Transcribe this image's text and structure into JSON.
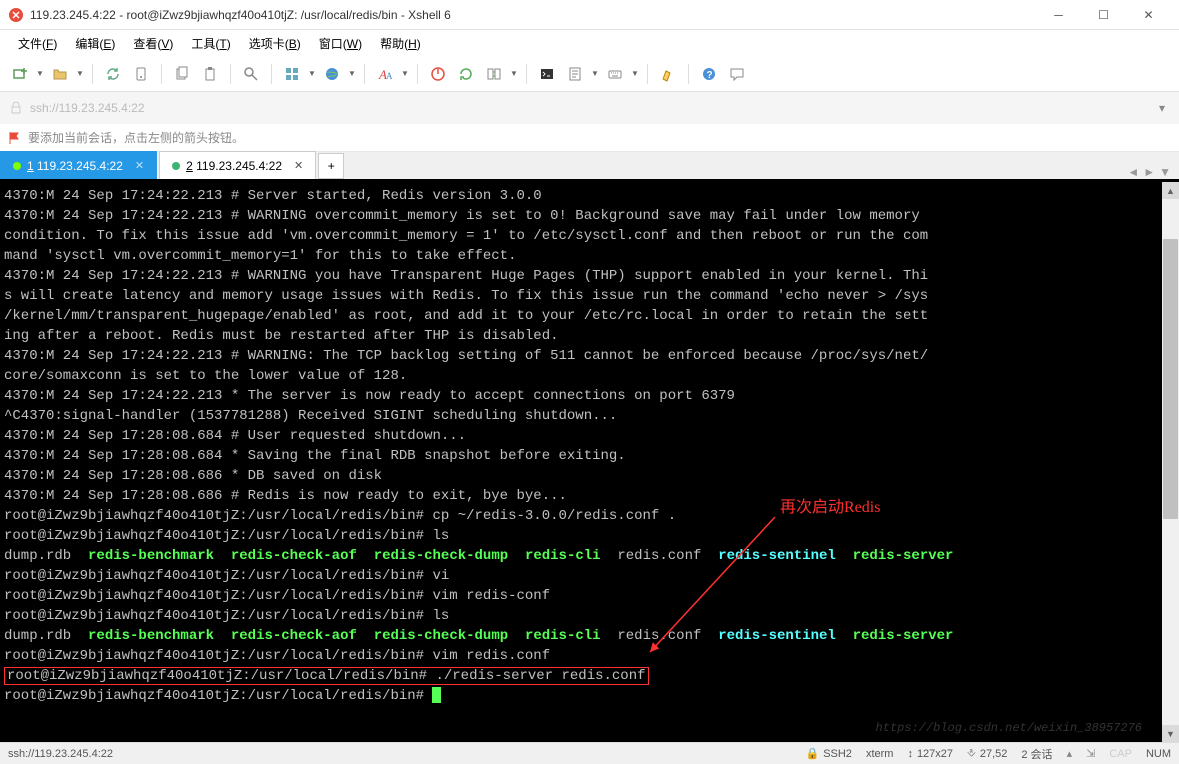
{
  "window": {
    "title": "119.23.245.4:22 - root@iZwz9bjiawhqzf40o410tjZ: /usr/local/redis/bin - Xshell 6"
  },
  "menu": {
    "items": [
      {
        "label": "文件",
        "key": "F"
      },
      {
        "label": "编辑",
        "key": "E"
      },
      {
        "label": "查看",
        "key": "V"
      },
      {
        "label": "工具",
        "key": "T"
      },
      {
        "label": "选项卡",
        "key": "B"
      },
      {
        "label": "窗口",
        "key": "W"
      },
      {
        "label": "帮助",
        "key": "H"
      }
    ]
  },
  "addressbar": {
    "text": "ssh://119.23.245.4:22"
  },
  "hint": {
    "text": "要添加当前会话，点击左侧的箭头按钮。"
  },
  "tabs": [
    {
      "num": "1",
      "label": "119.23.245.4:22",
      "active": true
    },
    {
      "num": "2",
      "label": "119.23.245.4:22",
      "active": false
    }
  ],
  "terminal": {
    "lines": [
      {
        "segs": [
          {
            "t": "4370:M 24 Sep 17:24:22.213 # Server started, Redis version 3.0.0"
          }
        ]
      },
      {
        "segs": [
          {
            "t": "4370:M 24 Sep 17:24:22.213 # WARNING overcommit_memory is set to 0! Background save may fail under low memory "
          }
        ]
      },
      {
        "segs": [
          {
            "t": "condition. To fix this issue add 'vm.overcommit_memory = 1' to /etc/sysctl.conf and then reboot or run the com"
          }
        ]
      },
      {
        "segs": [
          {
            "t": "mand 'sysctl vm.overcommit_memory=1' for this to take effect."
          }
        ]
      },
      {
        "segs": [
          {
            "t": "4370:M 24 Sep 17:24:22.213 # WARNING you have Transparent Huge Pages (THP) support enabled in your kernel. Thi"
          }
        ]
      },
      {
        "segs": [
          {
            "t": "s will create latency and memory usage issues with Redis. To fix this issue run the command 'echo never > /sys"
          }
        ]
      },
      {
        "segs": [
          {
            "t": "/kernel/mm/transparent_hugepage/enabled' as root, and add it to your /etc/rc.local in order to retain the sett"
          }
        ]
      },
      {
        "segs": [
          {
            "t": "ing after a reboot. Redis must be restarted after THP is disabled."
          }
        ]
      },
      {
        "segs": [
          {
            "t": "4370:M 24 Sep 17:24:22.213 # WARNING: The TCP backlog setting of 511 cannot be enforced because /proc/sys/net/"
          }
        ]
      },
      {
        "segs": [
          {
            "t": "core/somaxconn is set to the lower value of 128."
          }
        ]
      },
      {
        "segs": [
          {
            "t": "4370:M 24 Sep 17:24:22.213 * The server is now ready to accept connections on port 6379"
          }
        ]
      },
      {
        "segs": [
          {
            "t": "^C4370:signal-handler (1537781288) Received SIGINT scheduling shutdown..."
          }
        ]
      },
      {
        "segs": [
          {
            "t": "4370:M 24 Sep 17:28:08.684 # User requested shutdown..."
          }
        ]
      },
      {
        "segs": [
          {
            "t": "4370:M 24 Sep 17:28:08.684 * Saving the final RDB snapshot before exiting."
          }
        ]
      },
      {
        "segs": [
          {
            "t": "4370:M 24 Sep 17:28:08.686 * DB saved on disk"
          }
        ]
      },
      {
        "segs": [
          {
            "t": "4370:M 24 Sep 17:28:08.686 # Redis is now ready to exit, bye bye..."
          }
        ]
      },
      {
        "segs": [
          {
            "t": "root@iZwz9bjiawhqzf40o410tjZ:/usr/local/redis/bin# cp ~/redis-3.0.0/redis.conf ."
          }
        ]
      },
      {
        "segs": [
          {
            "t": "root@iZwz9bjiawhqzf40o410tjZ:/usr/local/redis/bin# ls"
          }
        ]
      },
      {
        "segs": [
          {
            "t": "dump.rdb  "
          },
          {
            "t": "redis-benchmark",
            "c": "green"
          },
          {
            "t": "  "
          },
          {
            "t": "redis-check-aof",
            "c": "green"
          },
          {
            "t": "  "
          },
          {
            "t": "redis-check-dump",
            "c": "green"
          },
          {
            "t": "  "
          },
          {
            "t": "redis-cli",
            "c": "green"
          },
          {
            "t": "  redis.conf  "
          },
          {
            "t": "redis-sentinel",
            "c": "cyan"
          },
          {
            "t": "  "
          },
          {
            "t": "redis-server",
            "c": "green"
          }
        ]
      },
      {
        "segs": [
          {
            "t": "root@iZwz9bjiawhqzf40o410tjZ:/usr/local/redis/bin# vi"
          }
        ]
      },
      {
        "segs": [
          {
            "t": "root@iZwz9bjiawhqzf40o410tjZ:/usr/local/redis/bin# vim redis-conf"
          }
        ]
      },
      {
        "segs": [
          {
            "t": "root@iZwz9bjiawhqzf40o410tjZ:/usr/local/redis/bin# ls"
          }
        ]
      },
      {
        "segs": [
          {
            "t": "dump.rdb  "
          },
          {
            "t": "redis-benchmark",
            "c": "green"
          },
          {
            "t": "  "
          },
          {
            "t": "redis-check-aof",
            "c": "green"
          },
          {
            "t": "  "
          },
          {
            "t": "redis-check-dump",
            "c": "green"
          },
          {
            "t": "  "
          },
          {
            "t": "redis-cli",
            "c": "green"
          },
          {
            "t": "  redis.conf  "
          },
          {
            "t": "redis-sentinel",
            "c": "cyan"
          },
          {
            "t": "  "
          },
          {
            "t": "redis-server",
            "c": "green"
          }
        ]
      },
      {
        "segs": [
          {
            "t": "root@iZwz9bjiawhqzf40o410tjZ:/usr/local/redis/bin# vim redis.conf"
          }
        ]
      },
      {
        "segs": [
          {
            "t": "root@iZwz9bjiawhqzf40o410tjZ:/usr/local/redis/bin# ./redis-server redis.conf"
          }
        ],
        "boxed": true
      },
      {
        "segs": [
          {
            "t": "root@iZwz9bjiawhqzf40o410tjZ:/usr/local/redis/bin# "
          }
        ],
        "cursor": true
      }
    ],
    "annotation": "再次启动Redis",
    "watermark": "https://blog.csdn.net/weixin_38957276"
  },
  "statusbar": {
    "left": "ssh://119.23.245.4:22",
    "ssh": "SSH2",
    "term": "xterm",
    "size": "127x27",
    "pos": "27,52",
    "sessions": "2 会话",
    "caps": "CAP",
    "num": "NUM"
  }
}
